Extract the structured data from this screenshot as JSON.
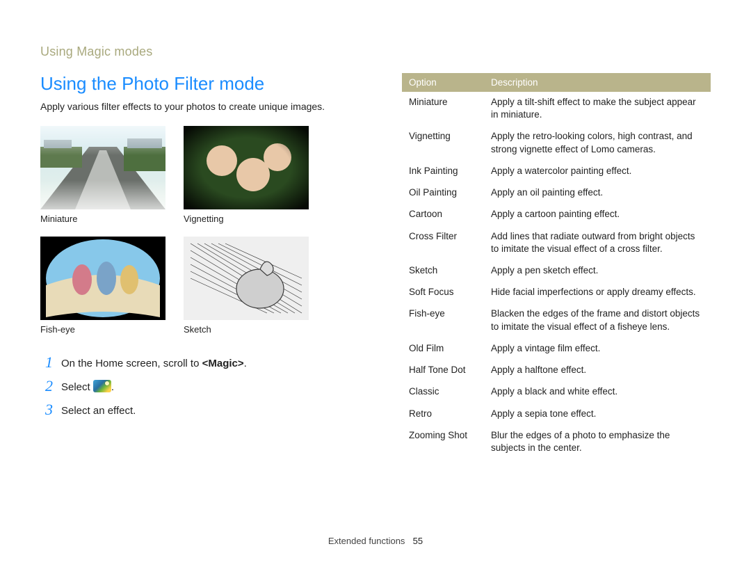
{
  "running_head": "Using Magic modes",
  "section_title": "Using the Photo Filter mode",
  "intro": "Apply various filter effects to your photos to create unique images.",
  "samples": {
    "row1": [
      {
        "caption": "Miniature"
      },
      {
        "caption": "Vignetting"
      }
    ],
    "row2": [
      {
        "caption": "Fish-eye"
      },
      {
        "caption": "Sketch"
      }
    ]
  },
  "steps": [
    {
      "num": "1",
      "text_pre": "On the Home screen, scroll to ",
      "bold": "<Magic>",
      "text_post": "."
    },
    {
      "num": "2",
      "text_pre": "Select ",
      "icon": true,
      "text_post": "."
    },
    {
      "num": "3",
      "text_pre": "Select an effect.",
      "text_post": ""
    }
  ],
  "table": {
    "headers": {
      "option": "Option",
      "description": "Description"
    },
    "rows": [
      {
        "option": "Miniature",
        "description": "Apply a tilt-shift effect to make the subject appear in miniature."
      },
      {
        "option": "Vignetting",
        "description": "Apply the retro-looking colors, high contrast, and strong vignette effect of Lomo cameras."
      },
      {
        "option": "Ink Painting",
        "description": "Apply a watercolor painting effect."
      },
      {
        "option": "Oil Painting",
        "description": "Apply an oil painting effect."
      },
      {
        "option": "Cartoon",
        "description": "Apply a cartoon painting effect."
      },
      {
        "option": "Cross Filter",
        "description": "Add lines that radiate outward from bright objects to imitate the visual effect of a cross filter."
      },
      {
        "option": "Sketch",
        "description": "Apply a pen sketch effect."
      },
      {
        "option": "Soft Focus",
        "description": "Hide facial imperfections or apply dreamy effects."
      },
      {
        "option": "Fish-eye",
        "description": "Blacken the edges of the frame and distort objects to imitate the visual effect of a fisheye lens."
      },
      {
        "option": "Old Film",
        "description": "Apply a vintage film effect."
      },
      {
        "option": "Half Tone Dot",
        "description": "Apply a halftone effect."
      },
      {
        "option": "Classic",
        "description": "Apply a black and white effect."
      },
      {
        "option": "Retro",
        "description": "Apply a sepia tone effect."
      },
      {
        "option": "Zooming Shot",
        "description": "Blur the edges of a photo to emphasize the subjects in the center."
      }
    ]
  },
  "footer": {
    "label": "Extended functions",
    "page": "55"
  }
}
